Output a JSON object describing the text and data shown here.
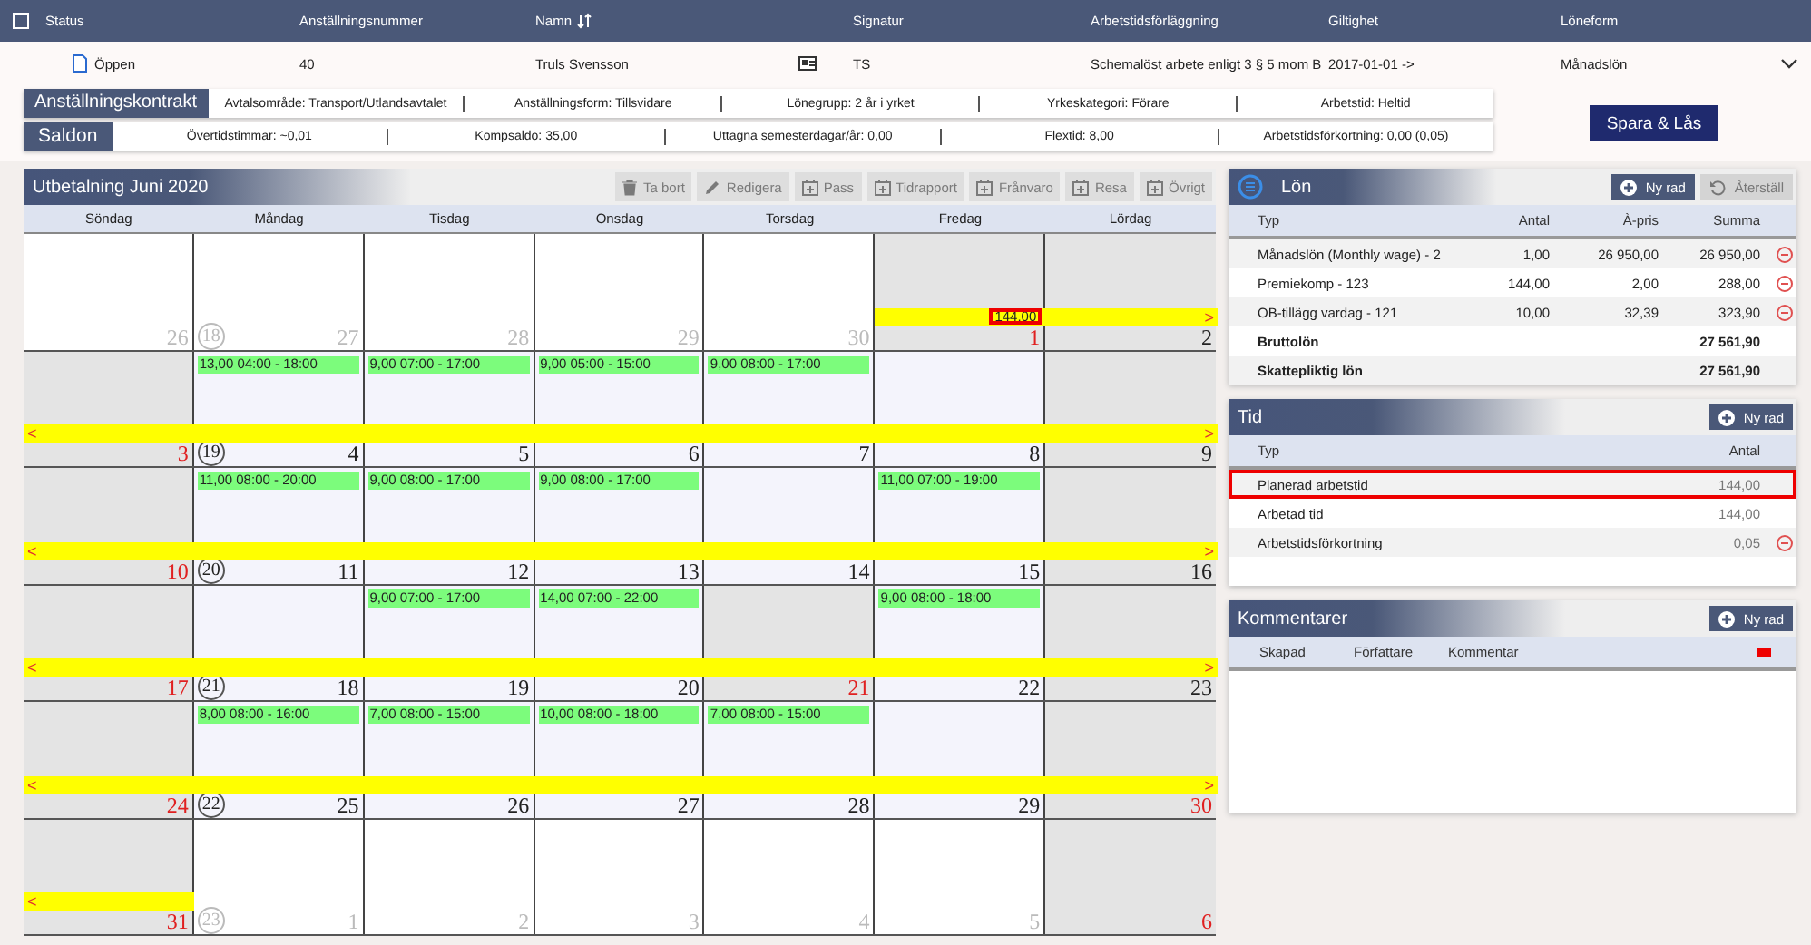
{
  "employee_table": {
    "select_all": {
      "checked": false
    },
    "columns": [
      {
        "label": "Status"
      },
      {
        "label": "Anställningsnummer"
      },
      {
        "label": "Namn",
        "sortable": true
      },
      {
        "label": "Signatur"
      },
      {
        "label": "Arbetstidsförläggning"
      },
      {
        "label": "Giltighet"
      },
      {
        "label": "Löneform"
      }
    ],
    "row": {
      "status": "Öppen",
      "number": "40",
      "name": "Truls Svensson",
      "signature": "TS",
      "schedule": "Schemalöst arbete enligt 3 § 5 mom B",
      "validity": "2017-01-01 ->",
      "pay_form": "Månadslön",
      "expanded": true
    }
  },
  "contract": {
    "label": "Anställningskontrakt",
    "fields": [
      "Avtalsområde: Transport/Utlandsavtalet",
      "Anställningsform: Tillsvidare",
      "Lönegrupp: 2 år i yrket",
      "Yrkeskategori: Förare",
      "Arbetstid: Heltid"
    ]
  },
  "balances": {
    "label": "Saldon",
    "fields": [
      "Övertidstimmar: ~0,01",
      "Kompsaldo: 35,00",
      "Uttagna semesterdagar/år: 0,00",
      "Flextid: 8,00",
      "Arbetstidsförkortning: 0,00 (0,05)"
    ]
  },
  "save_button": "Spara & Lås",
  "calendar": {
    "title": "Utbetalning Juni 2020",
    "toolbar": [
      {
        "label": "Ta bort",
        "kind": "trash",
        "disabled": true
      },
      {
        "label": "Redigera",
        "kind": "pencil",
        "disabled": true
      },
      {
        "label": "Pass",
        "kind": "calendar",
        "disabled": true
      },
      {
        "label": "Tidrapport",
        "kind": "calendar",
        "disabled": true
      },
      {
        "label": "Frånvaro",
        "kind": "calendar",
        "disabled": true
      },
      {
        "label": "Resa",
        "kind": "calendar",
        "disabled": true
      },
      {
        "label": "Övrigt",
        "kind": "calendar",
        "disabled": true
      }
    ],
    "weekdays": [
      "Söndag",
      "Måndag",
      "Tisdag",
      "Onsdag",
      "Torsdag",
      "Fredag",
      "Lördag"
    ],
    "weeks": [
      {
        "week": "18",
        "right_arrow": ">",
        "period_total": {
          "text": "144,00",
          "highlighted": true
        },
        "days": [
          {
            "day": "26",
            "kind": "outside",
            "muted": true,
            "red": false,
            "in_period": false
          },
          {
            "day": "27",
            "kind": "outside",
            "muted": true,
            "red": false,
            "in_period": false
          },
          {
            "day": "28",
            "kind": "outside",
            "muted": true,
            "red": false,
            "in_period": false
          },
          {
            "day": "29",
            "kind": "outside",
            "muted": true,
            "red": false,
            "in_period": false
          },
          {
            "day": "30",
            "kind": "outside",
            "muted": true,
            "red": false,
            "in_period": false
          },
          {
            "day": "1",
            "kind": "weekend",
            "muted": false,
            "red": true,
            "in_period": true
          },
          {
            "day": "2",
            "kind": "weekend",
            "muted": false,
            "red": false,
            "in_period": true
          }
        ]
      },
      {
        "week": "19",
        "left_arrow": "<",
        "right_arrow": ">",
        "days": [
          {
            "day": "3",
            "kind": "weekend",
            "muted": false,
            "red": true,
            "in_period": true
          },
          {
            "day": "4",
            "kind": "workday",
            "muted": false,
            "red": false,
            "in_period": true,
            "shift": "13,00 04:00 - 18:00"
          },
          {
            "day": "5",
            "kind": "workday",
            "muted": false,
            "red": false,
            "in_period": true,
            "shift": "9,00 07:00 - 17:00"
          },
          {
            "day": "6",
            "kind": "workday",
            "muted": false,
            "red": false,
            "in_period": true,
            "shift": "9,00 05:00 - 15:00"
          },
          {
            "day": "7",
            "kind": "workday",
            "muted": false,
            "red": false,
            "in_period": true,
            "shift": "9,00 08:00 - 17:00"
          },
          {
            "day": "8",
            "kind": "workday",
            "muted": false,
            "red": false,
            "in_period": true
          },
          {
            "day": "9",
            "kind": "weekend",
            "muted": false,
            "red": false,
            "in_period": true
          }
        ]
      },
      {
        "week": "20",
        "left_arrow": "<",
        "right_arrow": ">",
        "days": [
          {
            "day": "10",
            "kind": "weekend",
            "muted": false,
            "red": true,
            "in_period": true
          },
          {
            "day": "11",
            "kind": "workday",
            "muted": false,
            "red": false,
            "in_period": true,
            "shift": "11,00 08:00 - 20:00"
          },
          {
            "day": "12",
            "kind": "workday",
            "muted": false,
            "red": false,
            "in_period": true,
            "shift": "9,00 08:00 - 17:00"
          },
          {
            "day": "13",
            "kind": "workday",
            "muted": false,
            "red": false,
            "in_period": true,
            "shift": "9,00 08:00 - 17:00"
          },
          {
            "day": "14",
            "kind": "workday",
            "muted": false,
            "red": false,
            "in_period": true
          },
          {
            "day": "15",
            "kind": "workday",
            "muted": false,
            "red": false,
            "in_period": true,
            "shift": "11,00 07:00 - 19:00"
          },
          {
            "day": "16",
            "kind": "weekend",
            "muted": false,
            "red": false,
            "in_period": true
          }
        ]
      },
      {
        "week": "21",
        "left_arrow": "<",
        "right_arrow": ">",
        "days": [
          {
            "day": "17",
            "kind": "weekend",
            "muted": false,
            "red": true,
            "in_period": true
          },
          {
            "day": "18",
            "kind": "workday",
            "muted": false,
            "red": false,
            "in_period": true
          },
          {
            "day": "19",
            "kind": "workday",
            "muted": false,
            "red": false,
            "in_period": true,
            "shift": "9,00 07:00 - 17:00"
          },
          {
            "day": "20",
            "kind": "workday",
            "muted": false,
            "red": false,
            "in_period": true,
            "shift": "14,00 07:00 - 22:00"
          },
          {
            "day": "21",
            "kind": "weekend",
            "muted": false,
            "red": true,
            "in_period": true
          },
          {
            "day": "22",
            "kind": "workday",
            "muted": false,
            "red": false,
            "in_period": true,
            "shift": "9,00 08:00 - 18:00"
          },
          {
            "day": "23",
            "kind": "weekend",
            "muted": false,
            "red": false,
            "in_period": true
          }
        ]
      },
      {
        "week": "22",
        "left_arrow": "<",
        "right_arrow": ">",
        "days": [
          {
            "day": "24",
            "kind": "weekend",
            "muted": false,
            "red": true,
            "in_period": true
          },
          {
            "day": "25",
            "kind": "workday",
            "muted": false,
            "red": false,
            "in_period": true,
            "shift": "8,00 08:00 - 16:00"
          },
          {
            "day": "26",
            "kind": "workday",
            "muted": false,
            "red": false,
            "in_period": true,
            "shift": "7,00 08:00 - 15:00"
          },
          {
            "day": "27",
            "kind": "workday",
            "muted": false,
            "red": false,
            "in_period": true,
            "shift": "10,00 08:00 - 18:00"
          },
          {
            "day": "28",
            "kind": "workday",
            "muted": false,
            "red": false,
            "in_period": true,
            "shift": "7,00 08:00 - 15:00"
          },
          {
            "day": "29",
            "kind": "workday",
            "muted": false,
            "red": false,
            "in_period": true
          },
          {
            "day": "30",
            "kind": "weekend",
            "muted": false,
            "red": true,
            "in_period": true
          }
        ]
      },
      {
        "week": "23",
        "left_arrow": "<",
        "days": [
          {
            "day": "31",
            "kind": "weekend",
            "muted": false,
            "red": true,
            "in_period": true
          },
          {
            "day": "1",
            "kind": "outside",
            "muted": true,
            "red": false,
            "in_period": false
          },
          {
            "day": "2",
            "kind": "outside",
            "muted": true,
            "red": false,
            "in_period": false
          },
          {
            "day": "3",
            "kind": "outside",
            "muted": true,
            "red": false,
            "in_period": false
          },
          {
            "day": "4",
            "kind": "outside",
            "muted": true,
            "red": false,
            "in_period": false
          },
          {
            "day": "5",
            "kind": "outside",
            "muted": true,
            "red": false,
            "in_period": false
          },
          {
            "day": "6",
            "kind": "weekend",
            "muted": false,
            "red": true,
            "in_period": false
          }
        ]
      }
    ]
  },
  "salary": {
    "title": "Lön",
    "add_button": "Ny rad",
    "reset_button": {
      "label": "Återställ",
      "disabled": true
    },
    "columns": [
      "Typ",
      "Antal",
      "À-pris",
      "Summa"
    ],
    "rows": [
      {
        "kind": "item",
        "type": "Månadslön (Monthly wage) - 2",
        "quantity": "1,00",
        "price": "26 950,00",
        "sum": "26 950,00"
      },
      {
        "kind": "item",
        "type": "Premiekomp - 123",
        "quantity": "144,00",
        "price": "2,00",
        "sum": "288,00"
      },
      {
        "kind": "item",
        "type": "OB-tillägg vardag - 121",
        "quantity": "10,00",
        "price": "32,39",
        "sum": "323,90"
      },
      {
        "kind": "total",
        "type": "Bruttolön",
        "sum": "27 561,90"
      },
      {
        "kind": "total",
        "type": "Skattepliktig lön",
        "sum": "27 561,90"
      }
    ]
  },
  "time": {
    "title": "Tid",
    "add_button": "Ny rad",
    "columns": [
      "Typ",
      "Antal"
    ],
    "rows": [
      {
        "type": "Planerad arbetstid",
        "quantity": "144,00",
        "highlighted": true,
        "removable": false
      },
      {
        "type": "Arbetad tid",
        "quantity": "144,00",
        "highlighted": false,
        "removable": false
      },
      {
        "type": "Arbetstidsförkortning",
        "quantity": "0,05",
        "highlighted": false,
        "removable": true
      }
    ]
  },
  "comments": {
    "title": "Kommentarer",
    "add_button": "Ny rad",
    "columns": [
      "Skapad",
      "Författare",
      "Kommentar"
    ]
  }
}
